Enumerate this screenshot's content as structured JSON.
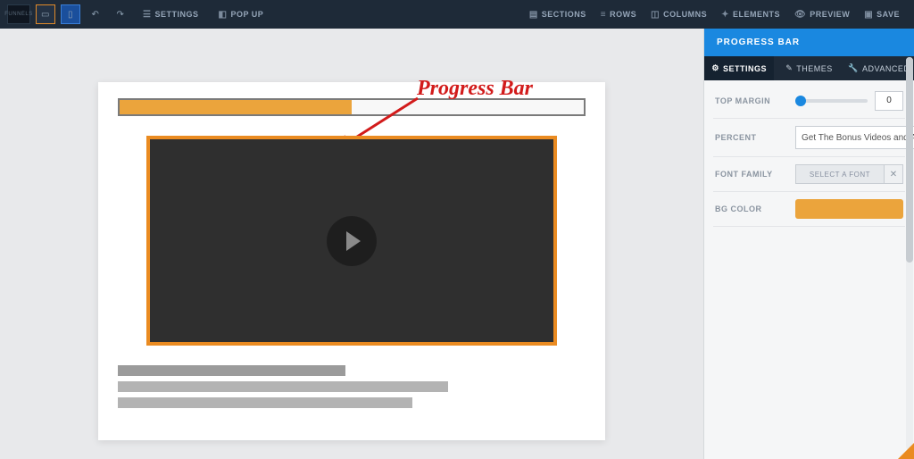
{
  "topbar": {
    "settings_label": "SETTINGS",
    "popup_label": "POP UP",
    "sections_label": "SECTIONS",
    "rows_label": "ROWS",
    "columns_label": "COLUMNS",
    "elements_label": "ELEMENTS",
    "preview_label": "PREVIEW",
    "save_label": "SAVE"
  },
  "canvas": {
    "progress_fill_percent": 50
  },
  "annotation": {
    "label": "Progress Bar"
  },
  "sidebar": {
    "title": "PROGRESS BAR",
    "tabs": {
      "settings": "SETTINGS",
      "themes": "THEMES",
      "advanced": "ADVANCED"
    },
    "rows": {
      "top_margin": {
        "label": "TOP MARGIN",
        "value": "0"
      },
      "percent": {
        "label": "PERCENT",
        "value": "Get The Bonus Videos and A"
      },
      "font": {
        "label": "FONT FAMILY",
        "button": "SELECT A FONT"
      },
      "bg": {
        "label": "BG COLOR",
        "color": "#eba43c"
      }
    }
  }
}
